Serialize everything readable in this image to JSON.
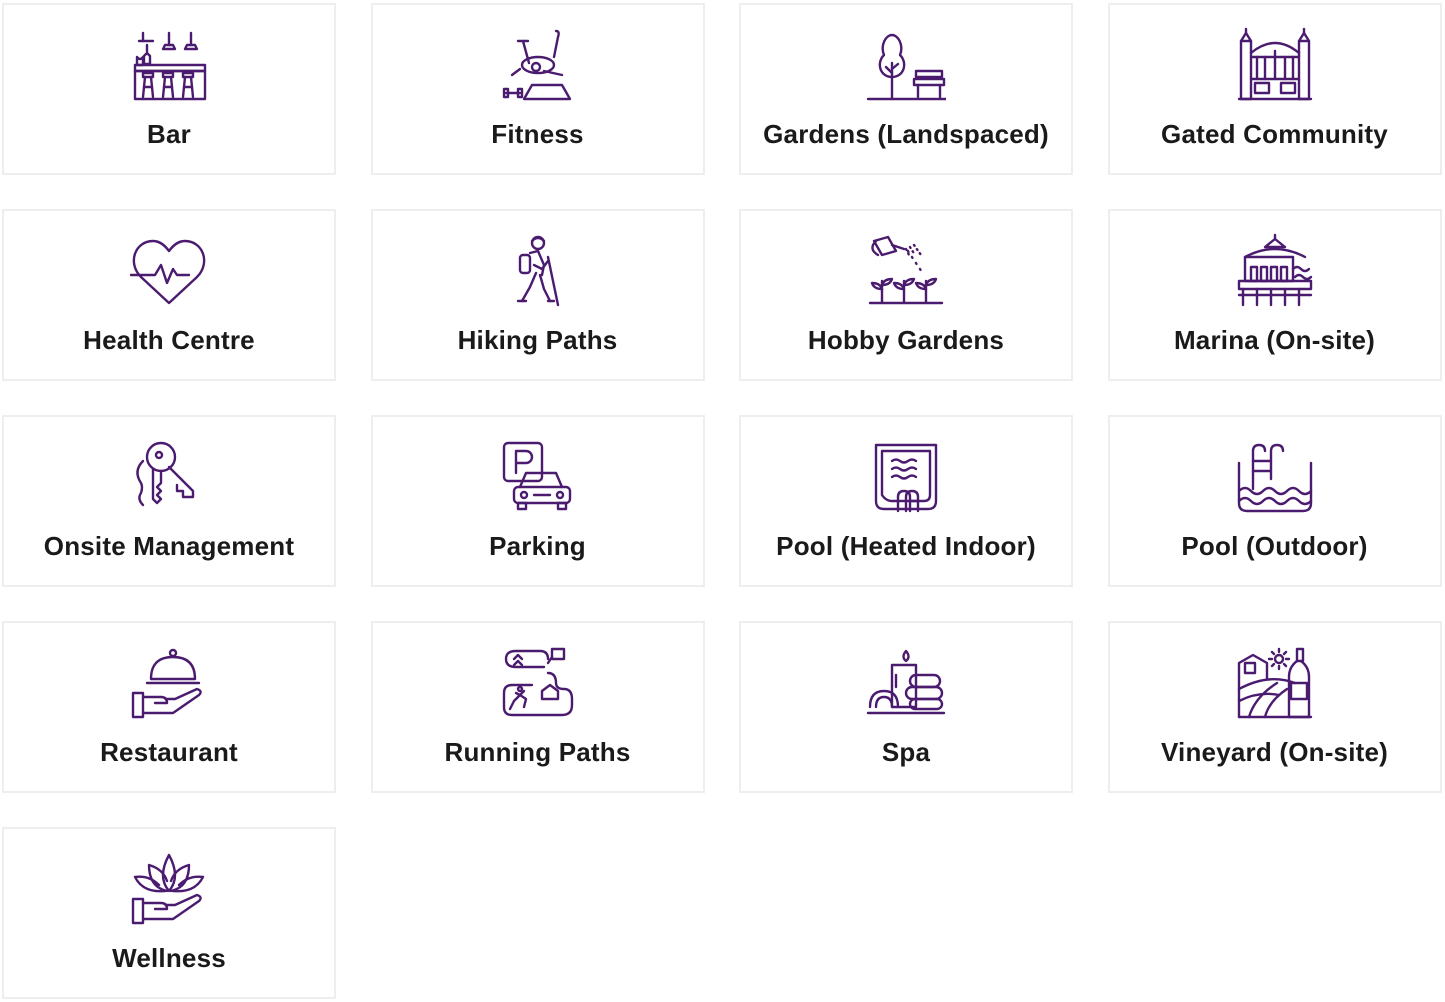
{
  "colors": {
    "icon_stroke": "#4b1b6f",
    "card_border": "#eeeeee",
    "label_text": "#1a1a1a"
  },
  "amenities": [
    {
      "label": "Bar",
      "icon": "bar-icon"
    },
    {
      "label": "Fitness",
      "icon": "fitness-bike-icon"
    },
    {
      "label": "Gardens (Landspaced)",
      "icon": "garden-tree-bench-icon"
    },
    {
      "label": "Gated Community",
      "icon": "gate-icon"
    },
    {
      "label": "Health Centre",
      "icon": "heart-pulse-icon"
    },
    {
      "label": "Hiking Paths",
      "icon": "hiker-icon"
    },
    {
      "label": "Hobby Gardens",
      "icon": "watering-can-icon"
    },
    {
      "label": "Marina (On-site)",
      "icon": "marina-building-icon"
    },
    {
      "label": "Onsite Management",
      "icon": "keys-icon"
    },
    {
      "label": "Parking",
      "icon": "parking-car-icon"
    },
    {
      "label": "Pool (Heated Indoor)",
      "icon": "indoor-pool-icon"
    },
    {
      "label": "Pool (Outdoor)",
      "icon": "outdoor-pool-ladder-icon"
    },
    {
      "label": "Restaurant",
      "icon": "cloche-hand-icon"
    },
    {
      "label": "Running Paths",
      "icon": "running-path-map-icon"
    },
    {
      "label": "Spa",
      "icon": "spa-stones-candle-icon"
    },
    {
      "label": "Vineyard (On-site)",
      "icon": "vineyard-wine-icon"
    },
    {
      "label": "Wellness",
      "icon": "lotus-hand-icon"
    }
  ]
}
